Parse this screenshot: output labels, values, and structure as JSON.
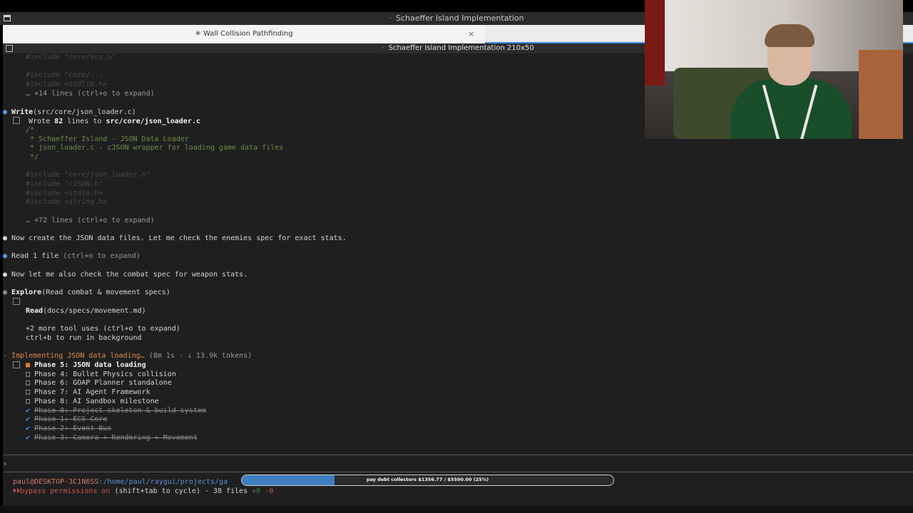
{
  "window": {
    "title": "Schaeffer Island Implementation",
    "tab_label": "✳ Wall Collision Pathfinding",
    "tab_close": "×",
    "pane_title": "Schaeffer Island Implementation 210x50"
  },
  "terminal": {
    "expand_14": "… +14 lines (ctrl+o to expand)",
    "write_tool": "Write",
    "write_arg": "(src/core/json_loader.c)",
    "wrote_prefix": "Wrote ",
    "wrote_count": "82",
    "wrote_mid": " lines to ",
    "wrote_file": "src/core/json_loader.c",
    "code_1": "/*",
    "code_2": " * Schaeffer Island - JSON Data Loader",
    "code_3": " * json_loader.c - cJSON wrapper for loading game data files",
    "code_4": " */",
    "expand_72": "… +72 lines (ctrl+o to expand)",
    "msg_create_json": "Now create the JSON data files. Let me check the enemies spec for exact stats.",
    "read_label": "Read",
    "read_rest": " 1 file ",
    "read_hint": "(ctrl+o to expand)",
    "msg_combat": "Now let me also check the combat spec for weapon stats.",
    "explore_tool": "Explore",
    "explore_arg": "(Read combat & movement specs)",
    "sub_read_tool": "Read",
    "sub_read_arg": "(docs/specs/movement.md)",
    "more_tools": "+2 more tool uses (ctrl+o to expand)",
    "bg_hint": "ctrl+b to run in background",
    "status_task": "Implementing JSON data loading…",
    "status_meta": " (8m 1s · ↓ 13.9k tokens)",
    "todos": [
      {
        "mark": "■",
        "text": "Phase 5: JSON data loading",
        "state": "active"
      },
      {
        "mark": "□",
        "text": "Phase 4: Bullet Physics collision",
        "state": "pending"
      },
      {
        "mark": "□",
        "text": "Phase 6: GOAP Planner standalone",
        "state": "pending"
      },
      {
        "mark": "□",
        "text": "Phase 7: AI Agent Framework",
        "state": "pending"
      },
      {
        "mark": "□",
        "text": "Phase 8: AI Sandbox milestone",
        "state": "pending"
      },
      {
        "mark": "✔",
        "text": "Phase 0: Project skeleton & build system",
        "state": "done"
      },
      {
        "mark": "✔",
        "text": "Phase 1: ECS Core",
        "state": "done"
      },
      {
        "mark": "✔",
        "text": "Phase 2: Event Bus",
        "state": "done"
      },
      {
        "mark": "✔",
        "text": "Phase 3: Camera + Rendering + Movement",
        "state": "done"
      }
    ],
    "input_prompt": "›",
    "shell_user": "paul@DESKTOP-3C1N6SS",
    "shell_path": ":/home/paul/raygui/projects/ga",
    "perm_mode": "bypass permissions on",
    "perm_hint": " (shift+tab to cycle) · 38 files ",
    "diff_add": "+0",
    "diff_del": "-0"
  },
  "overlay": {
    "progress_text": "pay debt collectors $1356.77 / $5500.00 (25%)",
    "progress_percent": 25,
    "fill_color": "#3f7fbf"
  },
  "colors": {
    "accent_blue": "#4d9cf0",
    "status_orange": "#e2894a",
    "terminal_bg": "#1f1f1f"
  }
}
